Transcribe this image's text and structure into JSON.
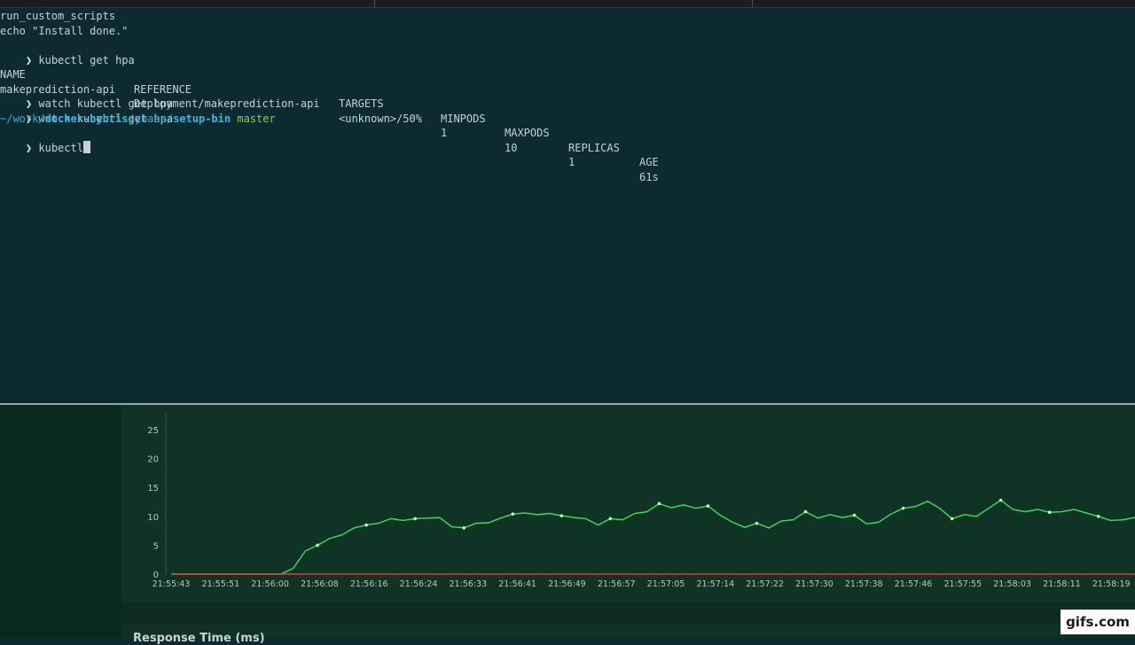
{
  "terminal": {
    "lines": [
      {
        "text": "run_custom_scripts"
      },
      {
        "text": "echo \"Install done.\""
      }
    ],
    "prompt_symbol": "❯",
    "cmd1": "kubectl get hpa",
    "table": {
      "headers": [
        "NAME",
        "REFERENCE",
        "TARGETS",
        "MINPODS",
        "MAXPODS",
        "REPLICAS",
        "AGE"
      ],
      "rows": [
        [
          "makeprediction-api",
          "Deployment/makeprediction-api",
          "<unknown>/50%",
          "1",
          "10",
          "1",
          "61s"
        ]
      ]
    },
    "cmd2": "watch kubectl get hpa",
    "cmd3": "watch kubectl get hpa",
    "path": {
      "tilde": "~/work/",
      "seg1": "docker-hybris",
      "sep1": "/ybase/",
      "seg2": "setup-bin",
      "branch": "master"
    },
    "current_input": "kubectl"
  },
  "chart_data": {
    "type": "line",
    "title": "",
    "xlabel": "",
    "ylabel": "",
    "ylim": [
      0,
      25
    ],
    "yticks": [
      0,
      5,
      10,
      15,
      20,
      25
    ],
    "xticks": [
      "21:55:43",
      "21:55:51",
      "21:56:00",
      "21:56:08",
      "21:56:16",
      "21:56:24",
      "21:56:33",
      "21:56:41",
      "21:56:49",
      "21:56:57",
      "21:57:05",
      "21:57:14",
      "21:57:22",
      "21:57:30",
      "21:57:38",
      "21:57:46",
      "21:57:55",
      "21:58:03",
      "21:58:11",
      "21:58:19"
    ],
    "series": [
      {
        "color": "#3fe05a",
        "values": [
          0,
          0,
          0,
          0,
          0,
          0,
          0,
          0,
          0,
          0,
          1,
          4,
          5,
          6.2,
          6.8,
          8,
          8.5,
          8.8,
          9.6,
          9.3,
          9.6,
          9.7,
          9.8,
          8.2,
          8.0,
          8.8,
          8.9,
          9.7,
          10.4,
          10.6,
          10.3,
          10.5,
          10.1,
          9.8,
          9.6,
          8.5,
          9.6,
          9.4,
          10.5,
          10.8,
          12.2,
          11.5,
          12,
          11.4,
          11.8,
          10.2,
          9.0,
          8.1,
          8.8,
          8.0,
          9.2,
          9.4,
          10.8,
          9.7,
          10.3,
          9.8,
          10.2,
          8.7,
          9.0,
          10.4,
          11.4,
          11.7,
          12.6,
          11.4,
          9.6,
          10.3,
          10.0,
          11.4,
          12.8,
          11.2,
          10.8,
          11.2,
          10.7,
          10.8,
          11.2,
          10.6,
          10.0,
          9.3,
          9.4,
          9.8
        ]
      },
      {
        "color": "#e03a3a",
        "values": [
          0,
          0,
          0,
          0,
          0,
          0,
          0,
          0,
          0,
          0,
          0,
          0,
          0,
          0,
          0,
          0,
          0,
          0,
          0,
          0,
          0,
          0,
          0,
          0,
          0,
          0,
          0,
          0,
          0,
          0,
          0,
          0,
          0,
          0,
          0,
          0,
          0,
          0,
          0,
          0,
          0,
          0,
          0,
          0,
          0,
          0,
          0,
          0,
          0,
          0,
          0,
          0,
          0,
          0,
          0,
          0,
          0,
          0,
          0,
          0,
          0,
          0,
          0,
          0,
          0,
          0,
          0,
          0,
          0,
          0,
          0,
          0,
          0,
          0,
          0,
          0,
          0,
          0,
          0,
          0
        ]
      }
    ]
  },
  "bottom_panel": {
    "title": "Response Time (ms)"
  },
  "watermark": "gifs.com",
  "colors": {
    "terminal_bg": "#0c2a30",
    "dashboard_bg": "#0f3325",
    "series_green": "#3fe05a",
    "series_red": "#e03a3a"
  }
}
